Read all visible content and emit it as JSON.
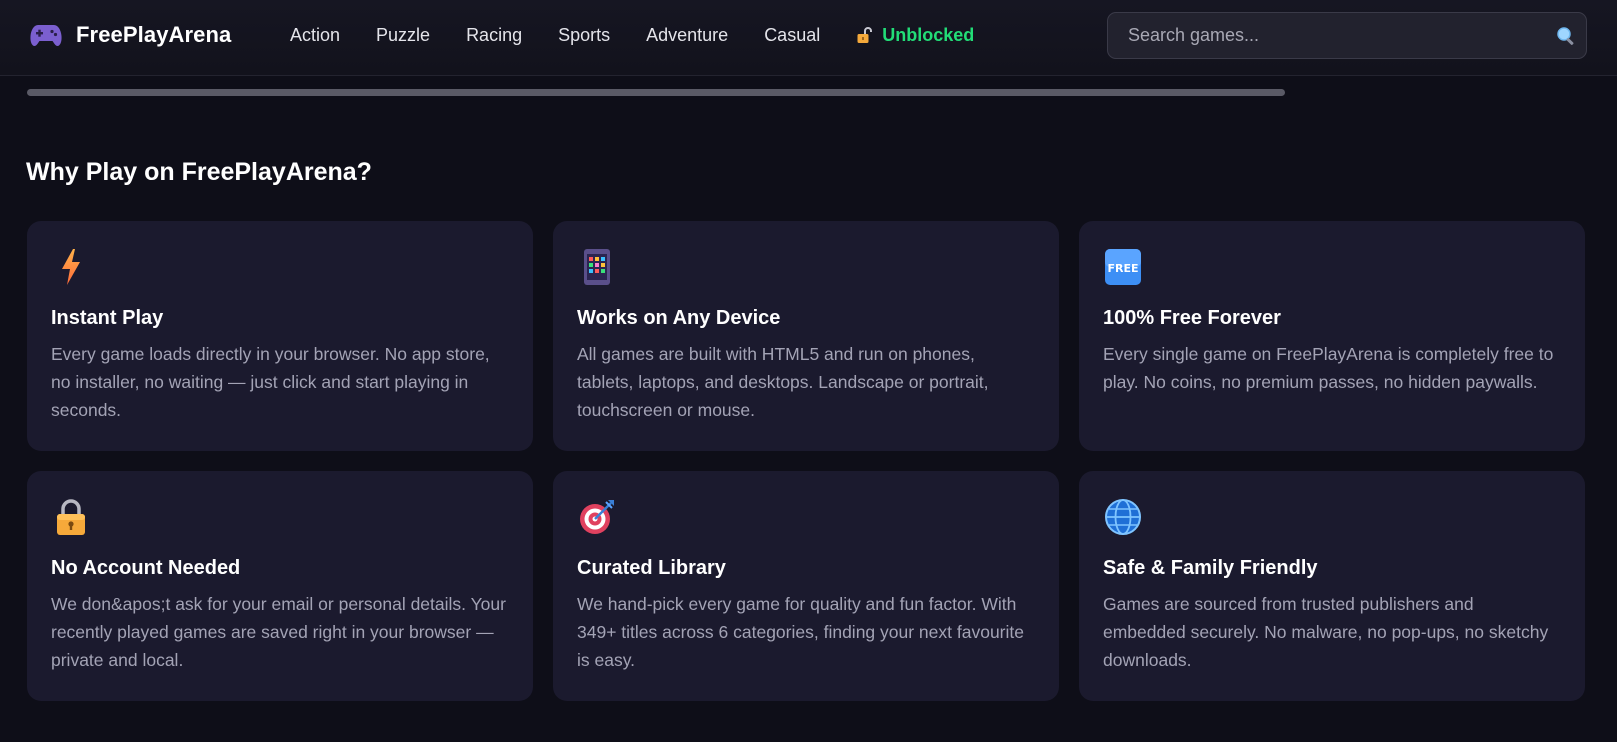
{
  "brand": {
    "name": "FreePlayArena",
    "icon": "gamepad-icon"
  },
  "nav": {
    "items": [
      "Action",
      "Puzzle",
      "Racing",
      "Sports",
      "Adventure",
      "Casual"
    ],
    "unblocked": {
      "label": "Unblocked",
      "icon": "open-lock-icon",
      "color": "#22dd77"
    }
  },
  "search": {
    "placeholder": "Search games...",
    "icon": "search-icon"
  },
  "section": {
    "title": "Why Play on FreePlayArena?"
  },
  "features": [
    {
      "icon": "lightning-icon",
      "title": "Instant Play",
      "text": "Every game loads directly in your browser. No app store, no installer, no waiting — just click and start playing in seconds."
    },
    {
      "icon": "mobile-device-icon",
      "title": "Works on Any Device",
      "text": "All games are built with HTML5 and run on phones, tablets, laptops, and desktops. Landscape or portrait, touchscreen or mouse."
    },
    {
      "icon": "free-badge-icon",
      "title": "100% Free Forever",
      "text": "Every single game on FreePlayArena is completely free to play. No coins, no premium passes, no hidden paywalls."
    },
    {
      "icon": "padlock-icon",
      "title": "No Account Needed",
      "text": "We don&apos;t ask for your email or personal details. Your recently played games are saved right in your browser — private and local."
    },
    {
      "icon": "target-icon",
      "title": "Curated Library",
      "text": "We hand-pick every game for quality and fun factor. With 349+ titles across 6 categories, finding your next favourite is easy."
    },
    {
      "icon": "globe-icon",
      "title": "Safe & Family Friendly",
      "text": "Games are sourced from trusted publishers and embedded securely. No malware, no pop-ups, no sketchy downloads."
    }
  ],
  "colors": {
    "background": "#0e0e18",
    "card": "#1b1a2e",
    "accent_green": "#22dd77"
  }
}
